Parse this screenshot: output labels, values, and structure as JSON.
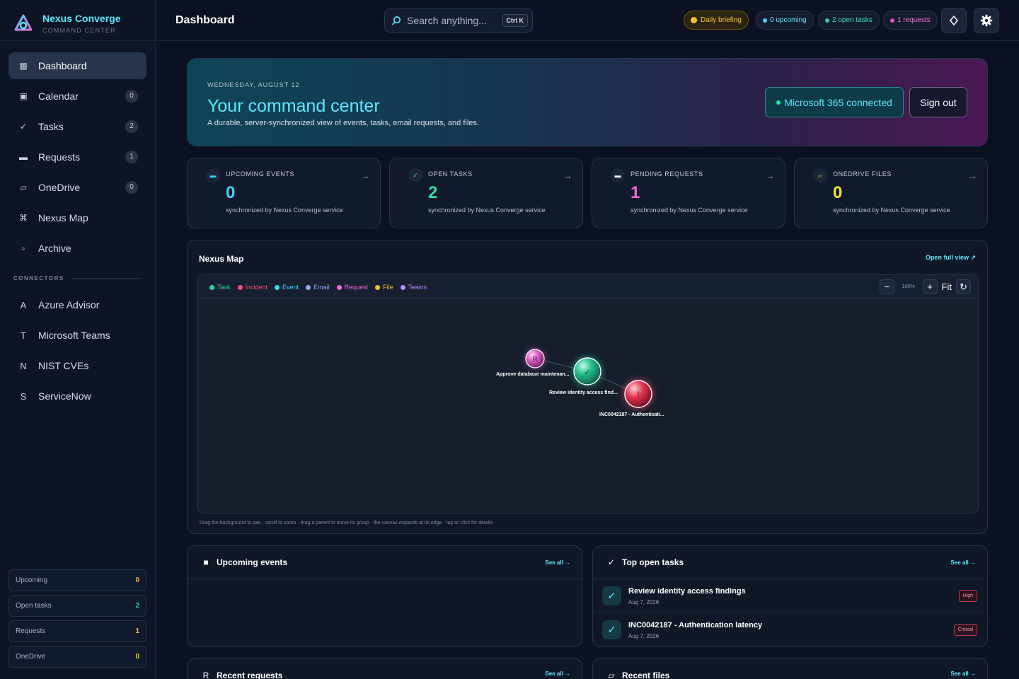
{
  "brand": {
    "name": "Nexus Converge",
    "subtitle": "COMMAND CENTER"
  },
  "nav": [
    {
      "icon": "▦",
      "label": "Dashboard",
      "badge": null
    },
    {
      "icon": "▣",
      "label": "Calendar",
      "badge": "0"
    },
    {
      "icon": "✓",
      "label": "Tasks",
      "badge": "2"
    },
    {
      "icon": "▬",
      "label": "Requests",
      "badge": "1"
    },
    {
      "icon": "▱",
      "label": "OneDrive",
      "badge": "0"
    },
    {
      "icon": "⌘",
      "label": "Nexus Map",
      "badge": null
    },
    {
      "icon": "▫",
      "label": "Archive",
      "badge": null
    }
  ],
  "connectors_heading": "CONNECTORS",
  "connectors": [
    {
      "letter": "A",
      "label": "Azure Advisor"
    },
    {
      "letter": "T",
      "label": "Microsoft Teams"
    },
    {
      "letter": "N",
      "label": "NIST CVEs"
    },
    {
      "letter": "S",
      "label": "ServiceNow"
    }
  ],
  "mini_stats": [
    {
      "label": "Upcoming",
      "value": "0",
      "color": "#f5c229"
    },
    {
      "label": "Open tasks",
      "value": "2",
      "color": "#2fd49f"
    },
    {
      "label": "Requests",
      "value": "1",
      "color": "#f5c229"
    },
    {
      "label": "OneDrive",
      "value": "0",
      "color": "#f5c229"
    }
  ],
  "topbar": {
    "title": "Dashboard",
    "search_placeholder": "Search anything...",
    "search_shortcut": "Ctrl K",
    "pills": {
      "briefing": "Daily briefing",
      "upcoming": "0 upcoming",
      "tasks": "2 open tasks",
      "requests": "1 requests"
    }
  },
  "hero": {
    "date": "WEDNESDAY, AUGUST 12",
    "title": "Your command center",
    "subtitle": "A durable, server-synchronized view of events, tasks, email requests, and files.",
    "connection": "Microsoft 365 connected",
    "signout": "Sign out"
  },
  "stats": [
    {
      "icon": "▬",
      "label": "UPCOMING EVENTS",
      "value": "0",
      "sub": "synchronized by Nexus Converge service",
      "color": "#3fd3ff",
      "icon_color": "#3fd3ff"
    },
    {
      "icon": "✓",
      "label": "OPEN TASKS",
      "value": "2",
      "sub": "synchronized by Nexus Converge service",
      "color": "#2fe0a6",
      "icon_color": "#2fe0a6"
    },
    {
      "icon": "▬",
      "label": "PENDING REQUESTS",
      "value": "1",
      "sub": "synchronized by Nexus Converge service",
      "color": "#f066d6",
      "icon_color": "#ffffff"
    },
    {
      "icon": "▱",
      "label": "ONEDRIVE FILES",
      "value": "0",
      "sub": "synchronized by Nexus Converge service",
      "color": "#f5e12e",
      "icon_color": "#f5c229"
    }
  ],
  "stat_arrow": "→",
  "map": {
    "title": "Nexus Map",
    "open_link": "Open full view ↗",
    "legend": [
      {
        "label": "Task",
        "color": "#2fd49f"
      },
      {
        "label": "Incident",
        "color": "#ff4d6d"
      },
      {
        "label": "Event",
        "color": "#3fd3ff"
      },
      {
        "label": "Email",
        "color": "#8fa8ff"
      },
      {
        "label": "Request",
        "color": "#f066d6"
      },
      {
        "label": "File",
        "color": "#f5c229"
      },
      {
        "label": "Teams",
        "color": "#b48cff"
      }
    ],
    "zoom_out": "−",
    "zoom_level": "100%",
    "zoom_in": "+",
    "fit": "Fit",
    "reset": "↻",
    "help": "Drag the background to pan · scroll to zoom · drag a parent to move its group · the canvas expands at its edge · tap or click for details",
    "nodes": [
      {
        "kind": "request",
        "glyph": "R",
        "label": "Approve database maintenan..."
      },
      {
        "kind": "task",
        "glyph": "✓",
        "label": "Review identity access find..."
      },
      {
        "kind": "incident",
        "glyph": "!",
        "label": "INC0042187 - Authenticati..."
      }
    ]
  },
  "panels": {
    "events": {
      "icon": "■",
      "title": "Upcoming events",
      "link": "See all →"
    },
    "tasks": {
      "icon": "✓",
      "title": "Top open tasks",
      "link": "See all →",
      "items": [
        {
          "title": "Review identity access findings",
          "date": "Aug 7, 2026",
          "priority": "High"
        },
        {
          "title": "INC0042187 - Authentication latency",
          "date": "Aug 7, 2026",
          "priority": "Critical"
        }
      ]
    },
    "requests": {
      "icon": "R",
      "title": "Recent requests",
      "link": "See all →"
    },
    "files": {
      "icon": "▱",
      "title": "Recent files",
      "link": "See all →"
    }
  }
}
